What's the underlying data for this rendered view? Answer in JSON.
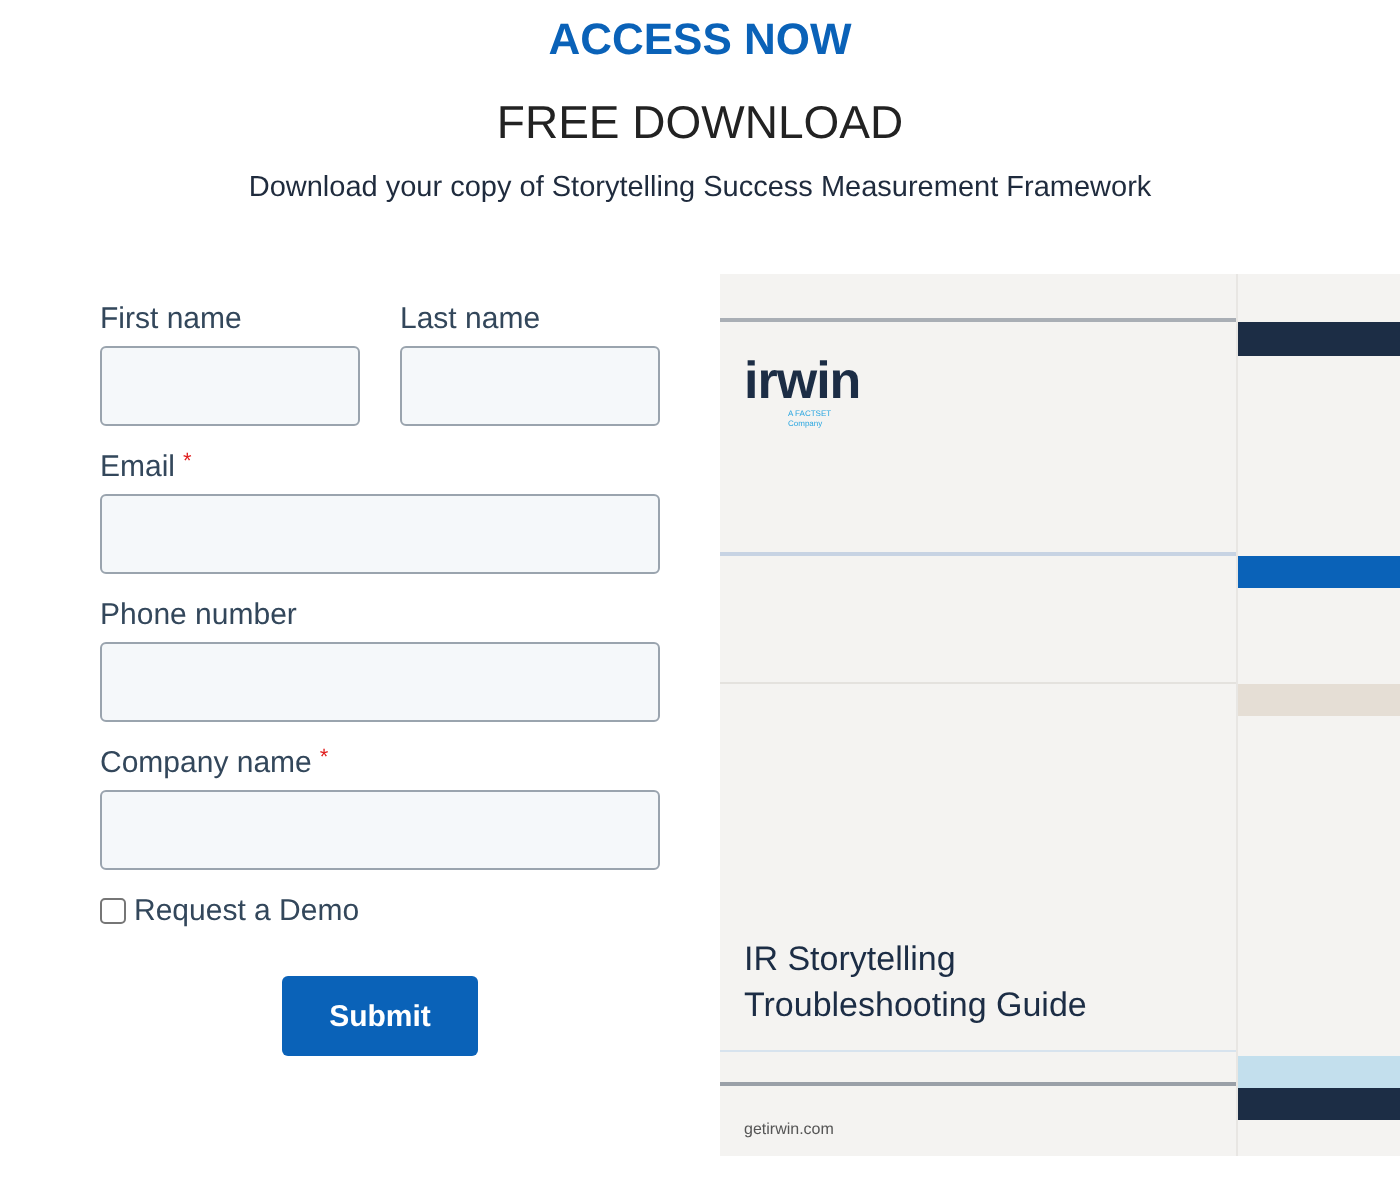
{
  "header": {
    "eyebrow": "ACCESS NOW",
    "title": "FREE DOWNLOAD",
    "subtitle": "Download your copy of Storytelling Success Measurement Framework"
  },
  "form": {
    "rows": [
      {
        "fields": [
          {
            "label": "First name"
          },
          {
            "label": "Last name"
          }
        ]
      },
      {
        "fields": [
          {
            "label": "Email",
            "required_mark": "*"
          }
        ]
      },
      {
        "fields": [
          {
            "label": "Phone number"
          }
        ]
      },
      {
        "fields": [
          {
            "label": "Company name",
            "required_mark": "*"
          }
        ]
      }
    ],
    "checkbox": {
      "label": "Request a Demo",
      "checked": false
    },
    "submit": "Submit"
  },
  "cover": {
    "logo": "irwin",
    "logo_tagline": "A FACTSET Company",
    "title_lines": [
      "IR Storytelling",
      "Troubleshooting Guide"
    ],
    "footer": "getirwin.com"
  }
}
